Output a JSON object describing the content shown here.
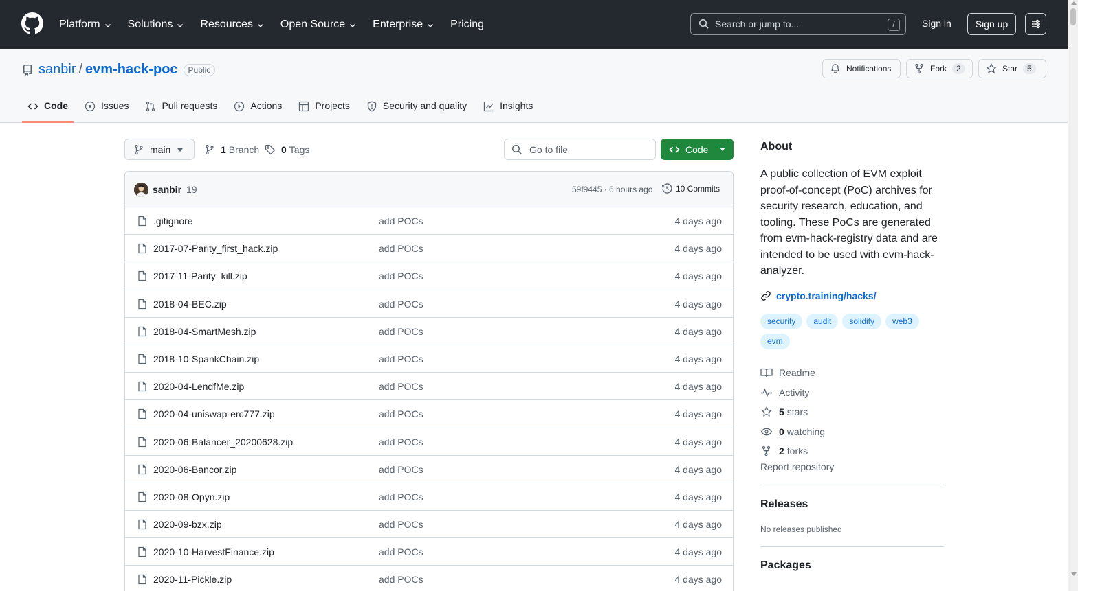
{
  "header": {
    "nav": [
      {
        "label": "Platform",
        "has_menu": true
      },
      {
        "label": "Solutions",
        "has_menu": true
      },
      {
        "label": "Resources",
        "has_menu": true
      },
      {
        "label": "Open Source",
        "has_menu": true
      },
      {
        "label": "Enterprise",
        "has_menu": true
      },
      {
        "label": "Pricing",
        "has_menu": false
      }
    ],
    "search_placeholder": "Search or jump to...",
    "search_shortcut": "/",
    "sign_in": "Sign in",
    "sign_up": "Sign up"
  },
  "repo": {
    "owner": "sanbir",
    "separator": "/",
    "name": "evm-hack-poc",
    "visibility": "Public",
    "notifications_label": "Notifications",
    "fork_label": "Fork",
    "fork_count": "2",
    "star_label": "Star",
    "star_count": "5"
  },
  "tabs": [
    {
      "label": "Code",
      "icon": "code-icon",
      "active": true
    },
    {
      "label": "Issues",
      "icon": "issue-icon",
      "active": false
    },
    {
      "label": "Pull requests",
      "icon": "pull-request-icon",
      "active": false
    },
    {
      "label": "Actions",
      "icon": "play-icon",
      "active": false
    },
    {
      "label": "Projects",
      "icon": "table-icon",
      "active": false
    },
    {
      "label": "Security and quality",
      "icon": "shield-icon",
      "active": false
    },
    {
      "label": "Insights",
      "icon": "graph-icon",
      "active": false
    }
  ],
  "toolbar": {
    "branch": "main",
    "branch_count": "1",
    "branch_label": "Branch",
    "tag_count": "0",
    "tag_label": "Tags",
    "go_to_file": "Go to file",
    "code_button": "Code"
  },
  "latest_commit": {
    "author": "sanbir",
    "message": "19",
    "hash_time": "59f9445 · 6 hours ago",
    "commits": "10 Commits"
  },
  "files": [
    {
      "name": ".gitignore",
      "commit": "add POCs",
      "age": "4 days ago"
    },
    {
      "name": "2017-07-Parity_first_hack.zip",
      "commit": "add POCs",
      "age": "4 days ago"
    },
    {
      "name": "2017-11-Parity_kill.zip",
      "commit": "add POCs",
      "age": "4 days ago"
    },
    {
      "name": "2018-04-BEC.zip",
      "commit": "add POCs",
      "age": "4 days ago"
    },
    {
      "name": "2018-04-SmartMesh.zip",
      "commit": "add POCs",
      "age": "4 days ago"
    },
    {
      "name": "2018-10-SpankChain.zip",
      "commit": "add POCs",
      "age": "4 days ago"
    },
    {
      "name": "2020-04-LendfMe.zip",
      "commit": "add POCs",
      "age": "4 days ago"
    },
    {
      "name": "2020-04-uniswap-erc777.zip",
      "commit": "add POCs",
      "age": "4 days ago"
    },
    {
      "name": "2020-06-Balancer_20200628.zip",
      "commit": "add POCs",
      "age": "4 days ago"
    },
    {
      "name": "2020-06-Bancor.zip",
      "commit": "add POCs",
      "age": "4 days ago"
    },
    {
      "name": "2020-08-Opyn.zip",
      "commit": "add POCs",
      "age": "4 days ago"
    },
    {
      "name": "2020-09-bzx.zip",
      "commit": "add POCs",
      "age": "4 days ago"
    },
    {
      "name": "2020-10-HarvestFinance.zip",
      "commit": "add POCs",
      "age": "4 days ago"
    },
    {
      "name": "2020-11-Pickle.zip",
      "commit": "add POCs",
      "age": "4 days ago"
    }
  ],
  "about": {
    "title": "About",
    "description": "A public collection of EVM exploit proof-of-concept (PoC) archives for security research, education, and tooling. These PoCs are generated from evm-hack-registry data and are intended to be used with evm-hack-analyzer.",
    "link": "crypto.training/hacks/",
    "topics": [
      "security",
      "audit",
      "solidity",
      "web3",
      "evm"
    ],
    "readme": "Readme",
    "activity": "Activity",
    "stars_count": "5",
    "stars_label": "stars",
    "watching_count": "0",
    "watching_label": "watching",
    "forks_count": "2",
    "forks_label": "forks",
    "report": "Report repository"
  },
  "releases": {
    "title": "Releases",
    "empty": "No releases published"
  },
  "packages": {
    "title": "Packages"
  },
  "colors": {
    "header_bg": "#24292f",
    "link": "#0969da",
    "primary_button": "#1f883d",
    "tab_underline": "#fd8c73",
    "topic_bg": "#ddf4ff"
  }
}
